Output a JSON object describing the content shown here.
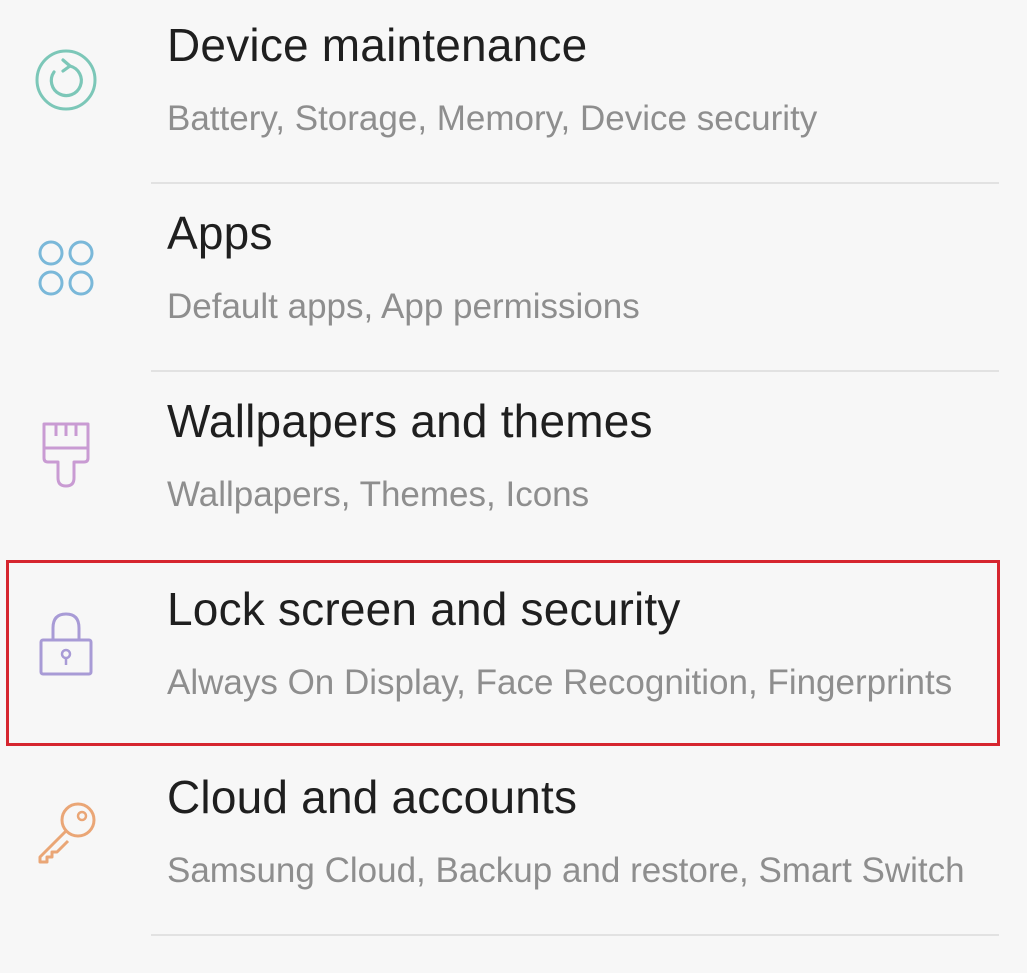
{
  "settings": {
    "items": [
      {
        "title": "Device maintenance",
        "subtitle": "Battery, Storage, Memory, Device security",
        "icon": "device-maintenance-icon",
        "icon_color": "#7cc7b8"
      },
      {
        "title": "Apps",
        "subtitle": "Default apps, App permissions",
        "icon": "apps-icon",
        "icon_color": "#7ab8d9"
      },
      {
        "title": "Wallpapers and themes",
        "subtitle": "Wallpapers, Themes, Icons",
        "icon": "paintbrush-icon",
        "icon_color": "#c99bd3"
      },
      {
        "title": "Lock screen and security",
        "subtitle": "Always On Display, Face Recognition, Fingerprints",
        "icon": "lock-icon",
        "icon_color": "#a89bd6",
        "highlighted": true
      },
      {
        "title": "Cloud and accounts",
        "subtitle": "Samsung Cloud, Backup and restore, Smart Switch",
        "icon": "key-icon",
        "icon_color": "#eaa676"
      }
    ],
    "highlight_color": "#d6262f"
  }
}
